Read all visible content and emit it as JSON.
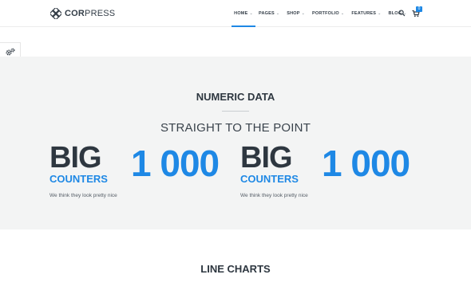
{
  "header": {
    "logo": {
      "bold": "COR",
      "regular": "PRESS",
      "icon": "diamond-logo-icon"
    },
    "nav": [
      {
        "label": "HOME",
        "has_dropdown": true,
        "active": true
      },
      {
        "label": "PAGES",
        "has_dropdown": true
      },
      {
        "label": "SHOP",
        "has_dropdown": true
      },
      {
        "label": "PORTFOLIO",
        "has_dropdown": true
      },
      {
        "label": "FEATURES",
        "has_dropdown": true
      },
      {
        "label": "BLOG",
        "has_dropdown": true
      }
    ],
    "search_icon": "search-icon",
    "cart_icon": "cart-icon",
    "cart_count": "0"
  },
  "side": {
    "settings_icon": "gears-icon"
  },
  "numeric": {
    "title": "NUMERIC DATA",
    "subtitle": "STRAIGHT TO THE POINT",
    "counters": [
      {
        "big": "BIG",
        "sub": "COUNTERS",
        "desc": "We think they look pretty nice",
        "number": "1 000"
      },
      {
        "big": "BIG",
        "sub": "COUNTERS",
        "desc": "We think they look pretty nice",
        "number": "1 000"
      }
    ]
  },
  "line_charts": {
    "title": "LINE CHARTS"
  },
  "colors": {
    "accent": "#1e88e5",
    "dark": "#2e3740",
    "section_bg": "#f3f4f4"
  }
}
